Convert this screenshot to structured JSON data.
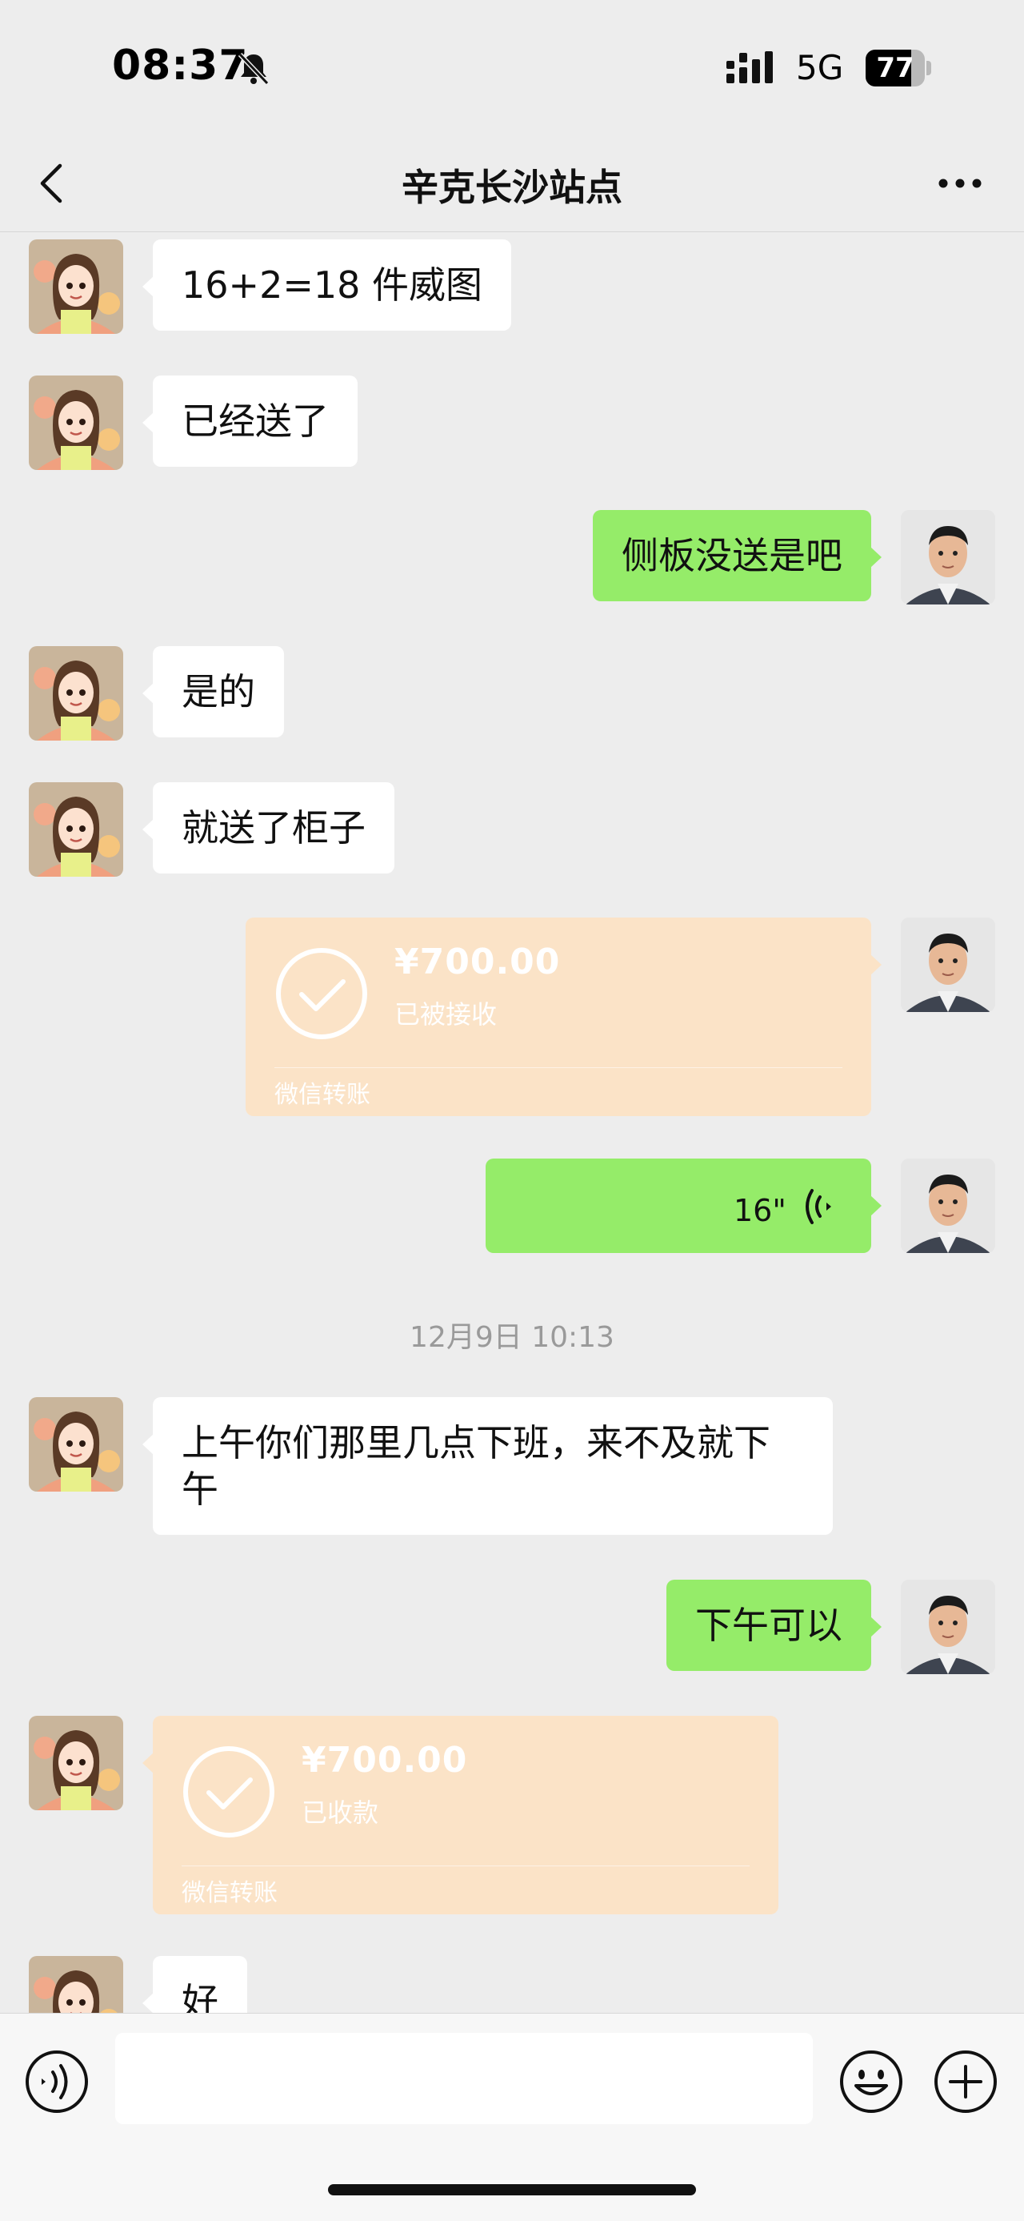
{
  "status_bar": {
    "time": "08:37",
    "network": "5G",
    "battery": "77",
    "battery_level": 0.77
  },
  "header": {
    "title": "辛克长沙站点"
  },
  "messages": [
    {
      "side": "left",
      "text": "16+2=18 件威图"
    },
    {
      "side": "left",
      "text": "已经送了"
    },
    {
      "side": "right",
      "text": "侧板没送是吧"
    },
    {
      "side": "left",
      "text": "是的"
    },
    {
      "side": "left",
      "text": "就送了柜子"
    },
    {
      "side": "right",
      "type": "transfer",
      "amount": "¥700.00",
      "status": "已被接收",
      "label": "微信转账"
    },
    {
      "side": "right",
      "type": "voice",
      "duration": "16\""
    },
    {
      "side": "left",
      "text": "上午你们那里几点下班，来不及就下午"
    },
    {
      "side": "right",
      "text": "下午可以"
    },
    {
      "side": "left",
      "type": "transfer",
      "amount": "¥700.00",
      "status": "已收款",
      "label": "微信转账"
    },
    {
      "side": "left",
      "text": "好"
    }
  ],
  "timestamp": "12月9日 10:13",
  "input": {
    "placeholder": ""
  },
  "colors": {
    "background": "#ededed",
    "sent_bubble": "#95ec69",
    "received_bubble": "#ffffff",
    "transfer_card": "#fbe3c7"
  },
  "icons": {
    "back": "chevron-left-icon",
    "more": "more-dots-icon",
    "mute": "bell-off-icon",
    "voice": "voice-wave-icon",
    "emoji": "emoji-icon",
    "plus": "plus-icon"
  }
}
